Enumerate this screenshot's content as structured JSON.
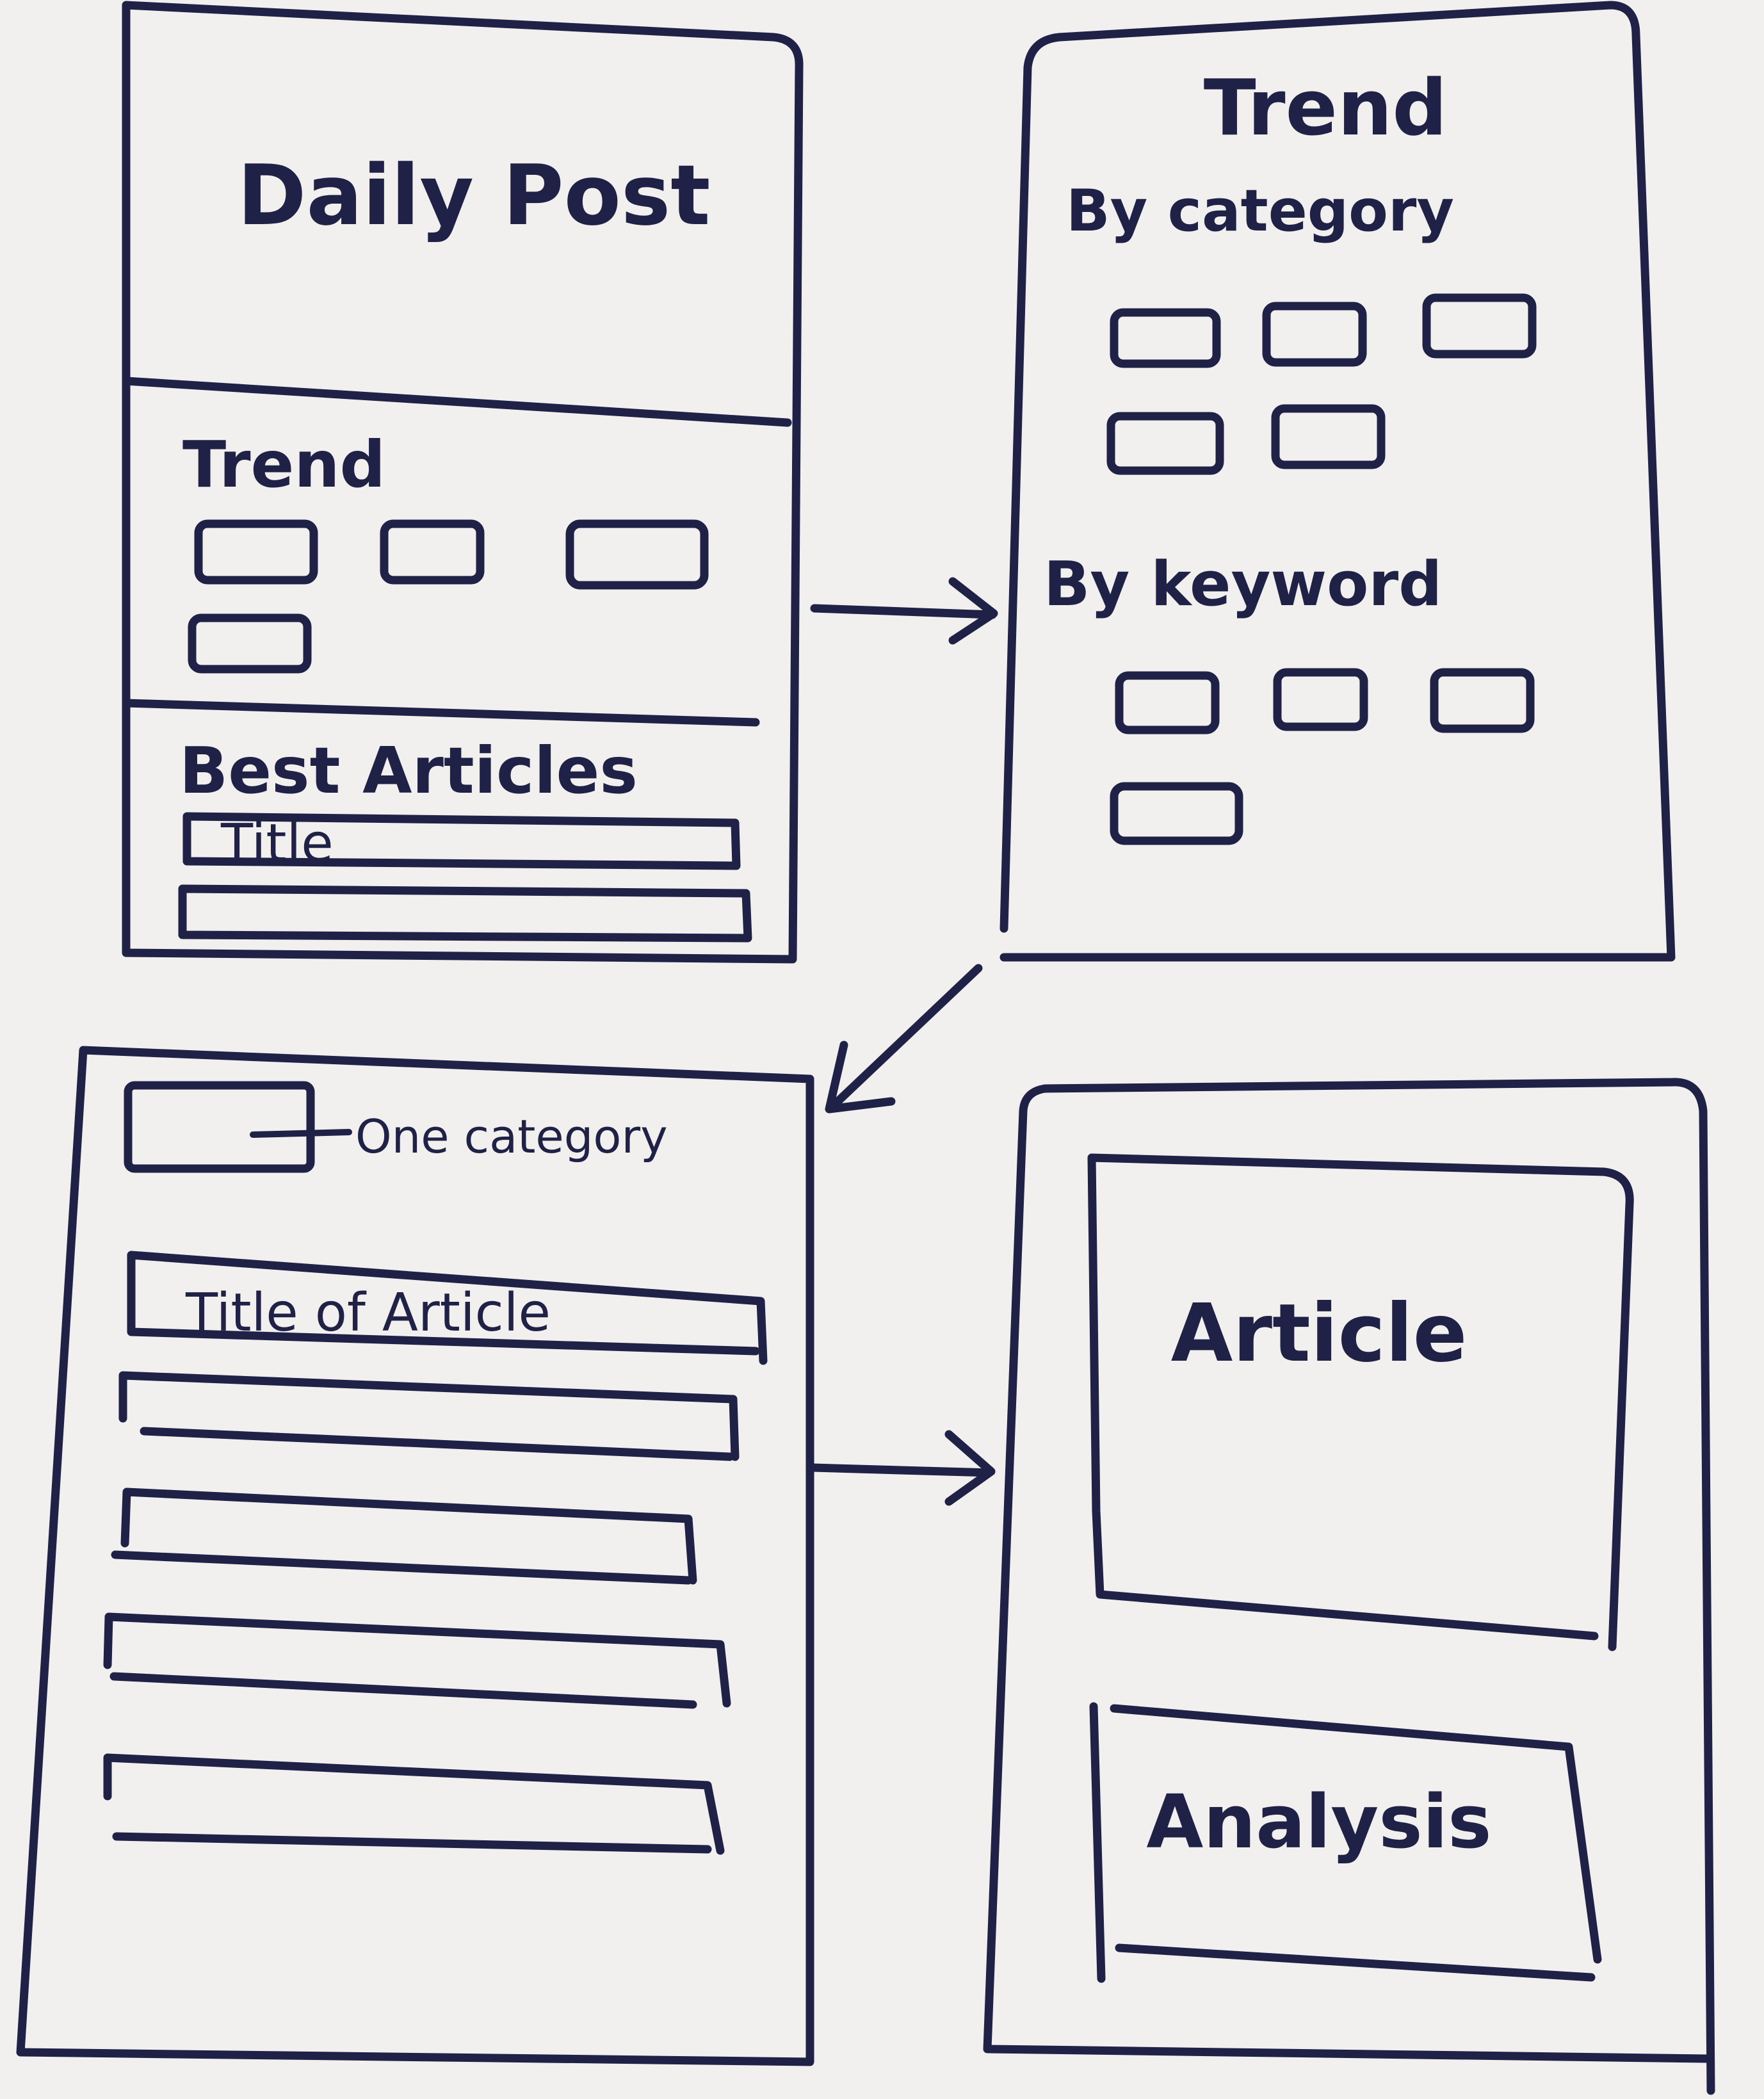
{
  "screens": {
    "home": {
      "title": "Daily Post",
      "trend_heading": "Trend",
      "best_heading": "Best Articles",
      "best_first_item": "Title"
    },
    "trend": {
      "title": "Trend",
      "by_category_heading": "By category",
      "by_keyword_heading": "By keyword"
    },
    "category_list": {
      "category_annotation": "One category",
      "first_item": "Title of Article"
    },
    "article": {
      "article_label": "Article",
      "analysis_label": "Analysis"
    }
  },
  "colors": {
    "ink": "#1f2147",
    "paper": "#f1f0ee"
  }
}
